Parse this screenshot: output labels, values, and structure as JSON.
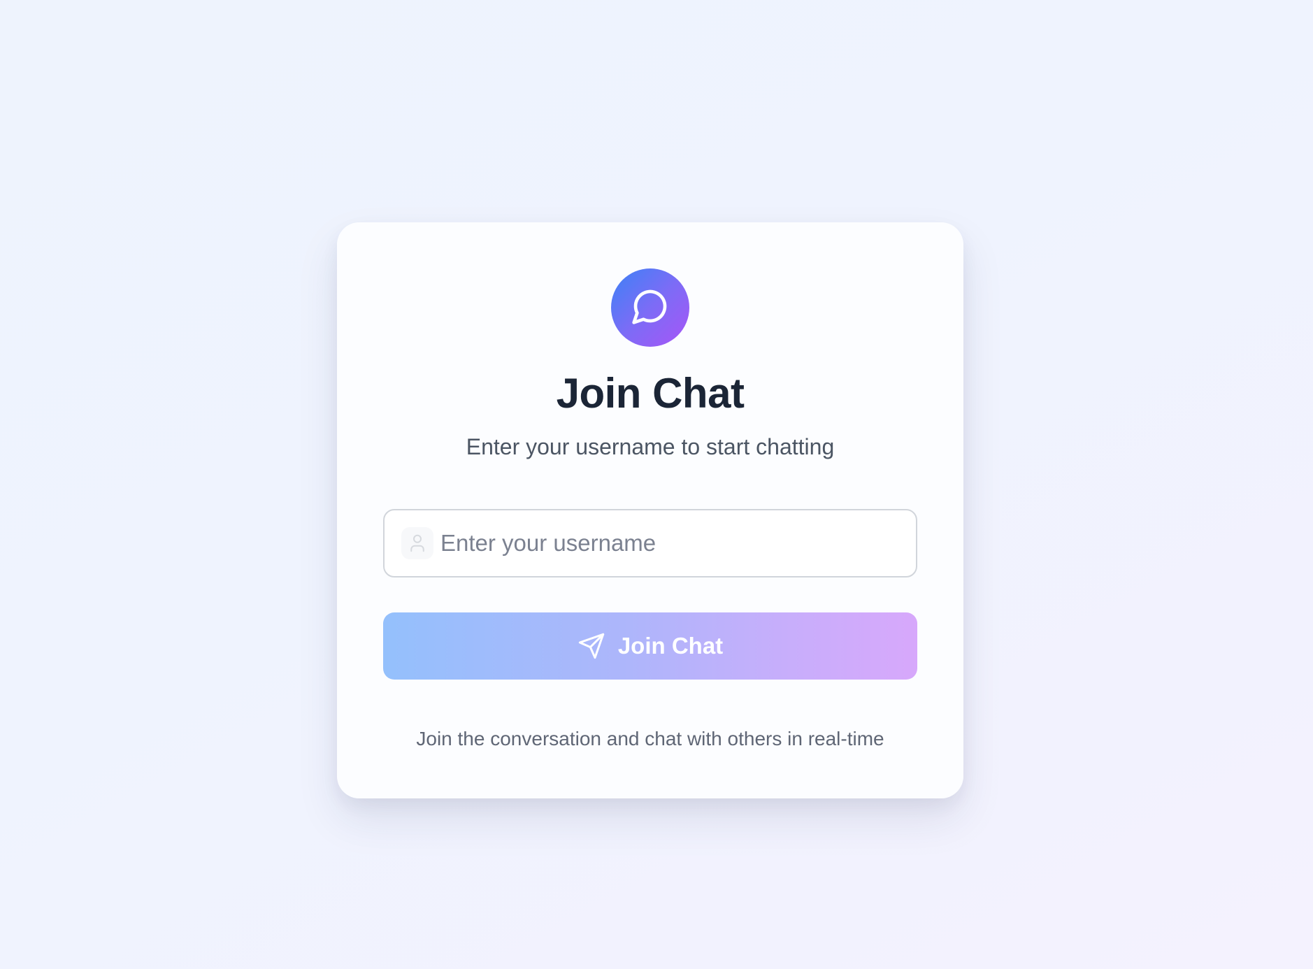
{
  "app": {
    "title": "Join Chat",
    "subtitle": "Enter your username to start chatting"
  },
  "logo": {
    "icon": "chat-bubble-icon",
    "gradient_start": "#3b82f6",
    "gradient_end": "#a855f7"
  },
  "form": {
    "username": {
      "value": "",
      "placeholder": "Enter your username",
      "icon": "user-icon"
    },
    "submit": {
      "label": "Join Chat",
      "icon": "send-icon",
      "state": "disabled-looking (faded gradient)"
    }
  },
  "footer": {
    "text": "Join the conversation and chat with others in real-time"
  },
  "colors": {
    "title": "#1b2536",
    "subtitle": "#4b5563",
    "button_gradient_start": "#94c0fc",
    "button_gradient_end": "#d7a8fb"
  }
}
